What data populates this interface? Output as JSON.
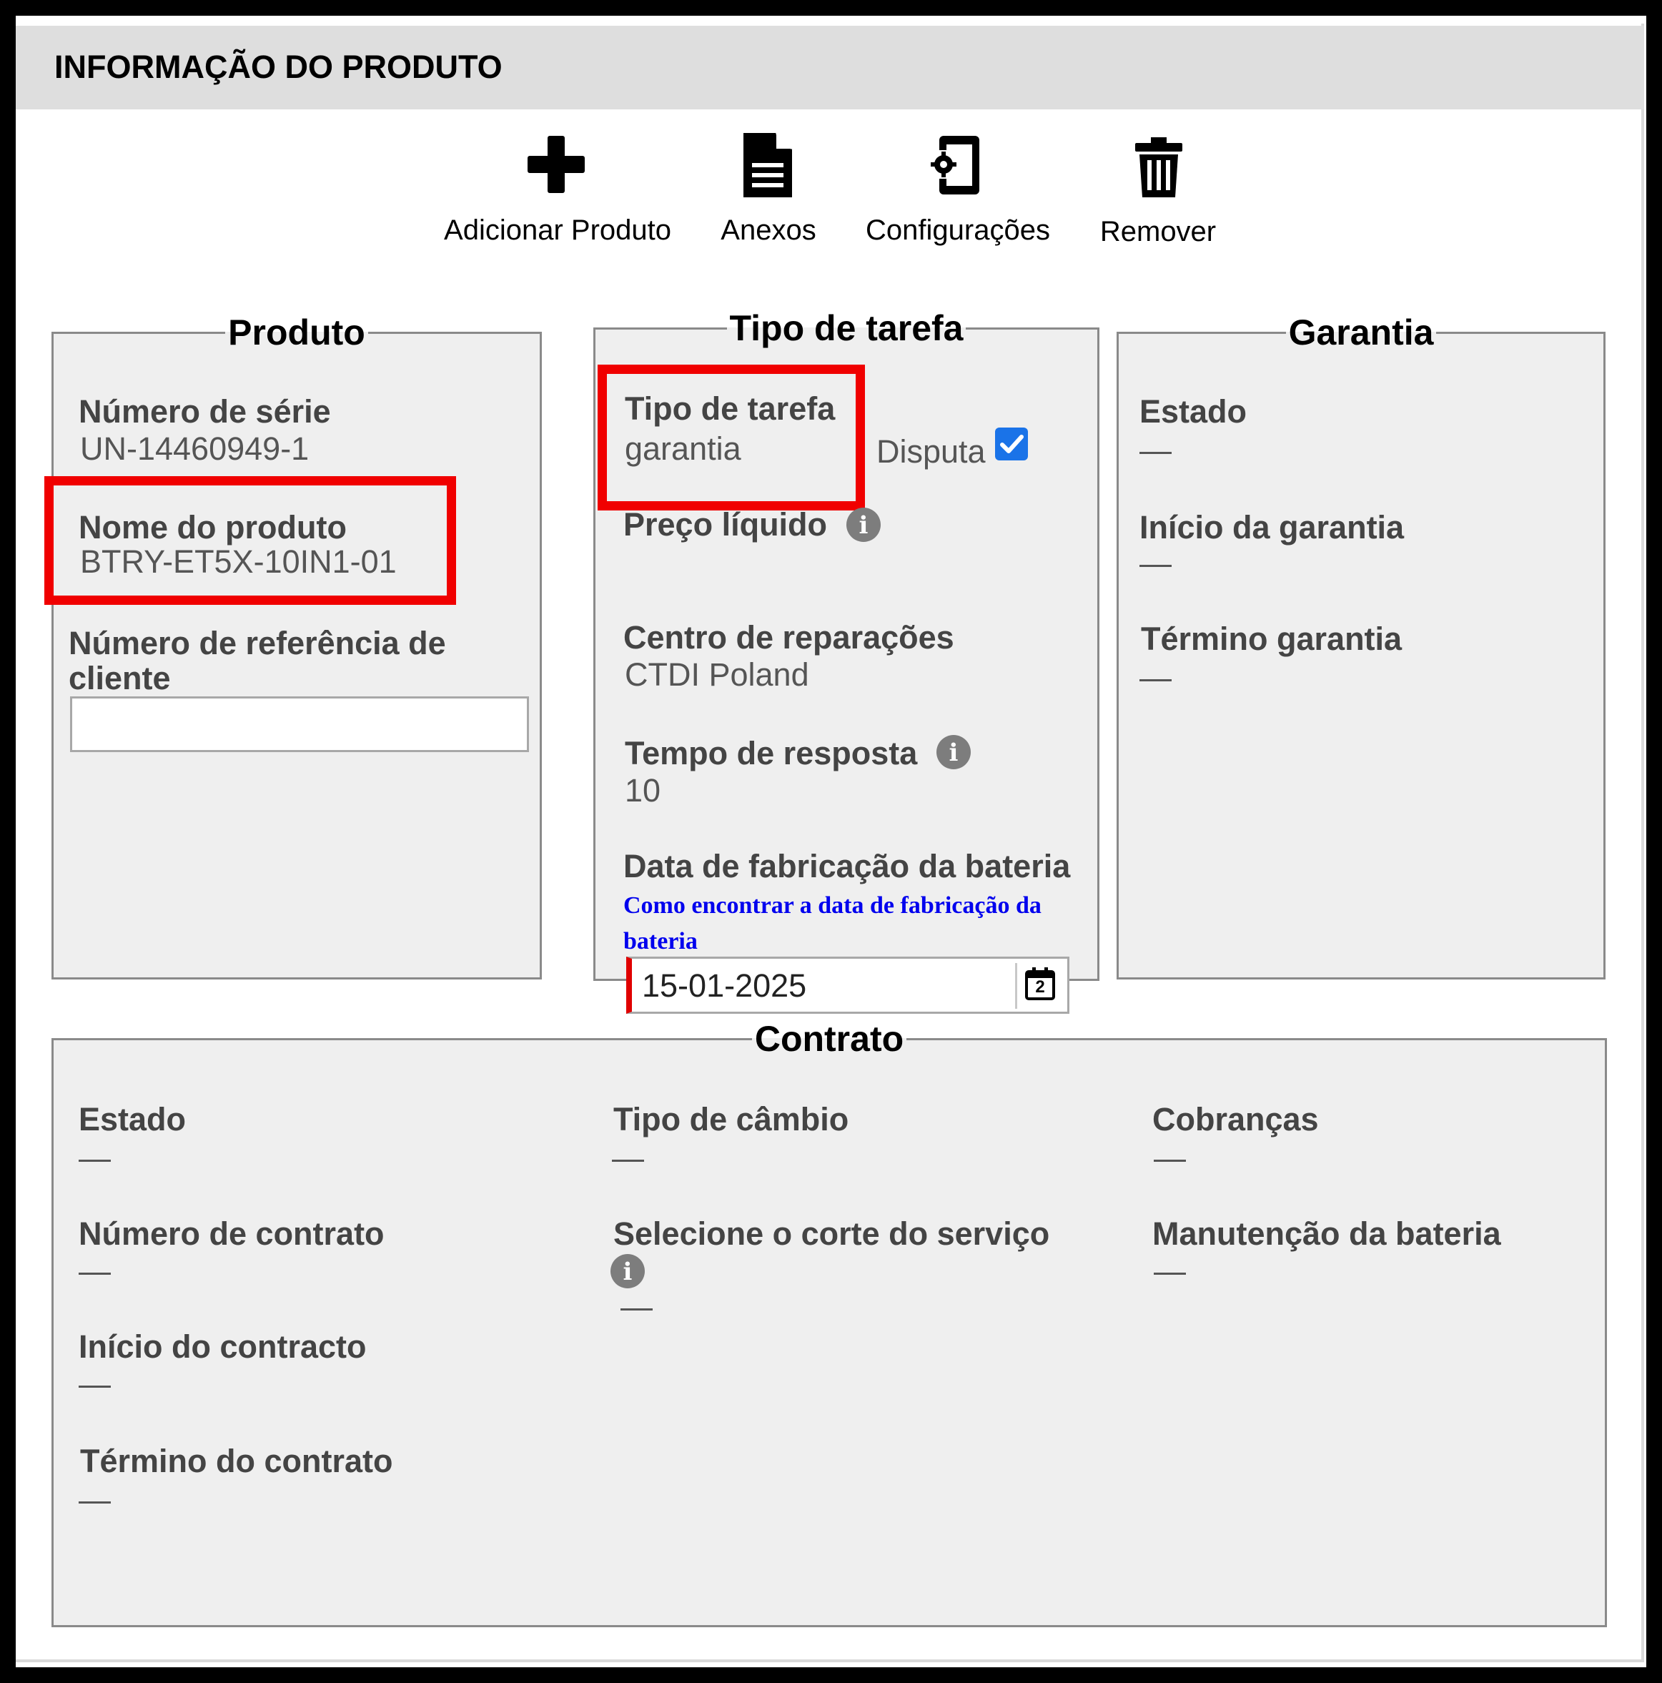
{
  "header": {
    "title": "INFORMAÇÃO DO PRODUTO"
  },
  "toolbar": {
    "add": {
      "label": "Adicionar Produto",
      "icon": "plus-icon"
    },
    "attachments": {
      "label": "Anexos",
      "icon": "document-icon"
    },
    "settings": {
      "label": "Configurações",
      "icon": "device-settings-icon"
    },
    "remove": {
      "label": "Remover",
      "icon": "trash-icon"
    }
  },
  "produto": {
    "legend": "Produto",
    "serial_label": "Número de série",
    "serial_value": "UN-14460949-1",
    "name_label": "Nome do produto",
    "name_value": "BTRY-ET5X-10IN1-01",
    "ref_label_line1": "Número de referência de",
    "ref_label_line2": "cliente",
    "ref_value": ""
  },
  "tarefa": {
    "legend": "Tipo de tarefa",
    "type_label": "Tipo de tarefa",
    "type_value": "garantia",
    "dispute_label": "Disputa",
    "dispute_checked": true,
    "price_label": "Preço líquido",
    "repair_label": "Centro de reparações",
    "repair_value": "CTDI Poland",
    "response_label": "Tempo de resposta",
    "response_value": "10",
    "battery_label": "Data de fabricação da bateria",
    "battery_link_line1": "Como encontrar a data de fabricação da",
    "battery_link_line2": "bateria",
    "battery_date": "15-01-2025",
    "calendar_day": "2"
  },
  "garantia": {
    "legend": "Garantia",
    "state_label": "Estado",
    "state_value": "—",
    "start_label": "Início da garantia",
    "start_value": "—",
    "end_label": "Término garantia",
    "end_value": "—"
  },
  "contrato": {
    "legend": "Contrato",
    "state_label": "Estado",
    "state_value": "—",
    "number_label": "Número de contrato",
    "number_value": "—",
    "start_label": "Início do contracto",
    "start_value": "—",
    "end_label": "Término do contrato",
    "end_value": "—",
    "exchange_label": "Tipo de câmbio",
    "exchange_value": "—",
    "cut_label": "Selecione o corte do serviço",
    "cut_value": "—",
    "charges_label": "Cobranças",
    "charges_value": "—",
    "battery_label": "Manutenção da bateria",
    "battery_value": "—"
  },
  "colors": {
    "highlight": "#f00000",
    "link": "#0000ee",
    "checkbox": "#1a73e8",
    "panel": "#efefef",
    "header": "#dedede"
  }
}
